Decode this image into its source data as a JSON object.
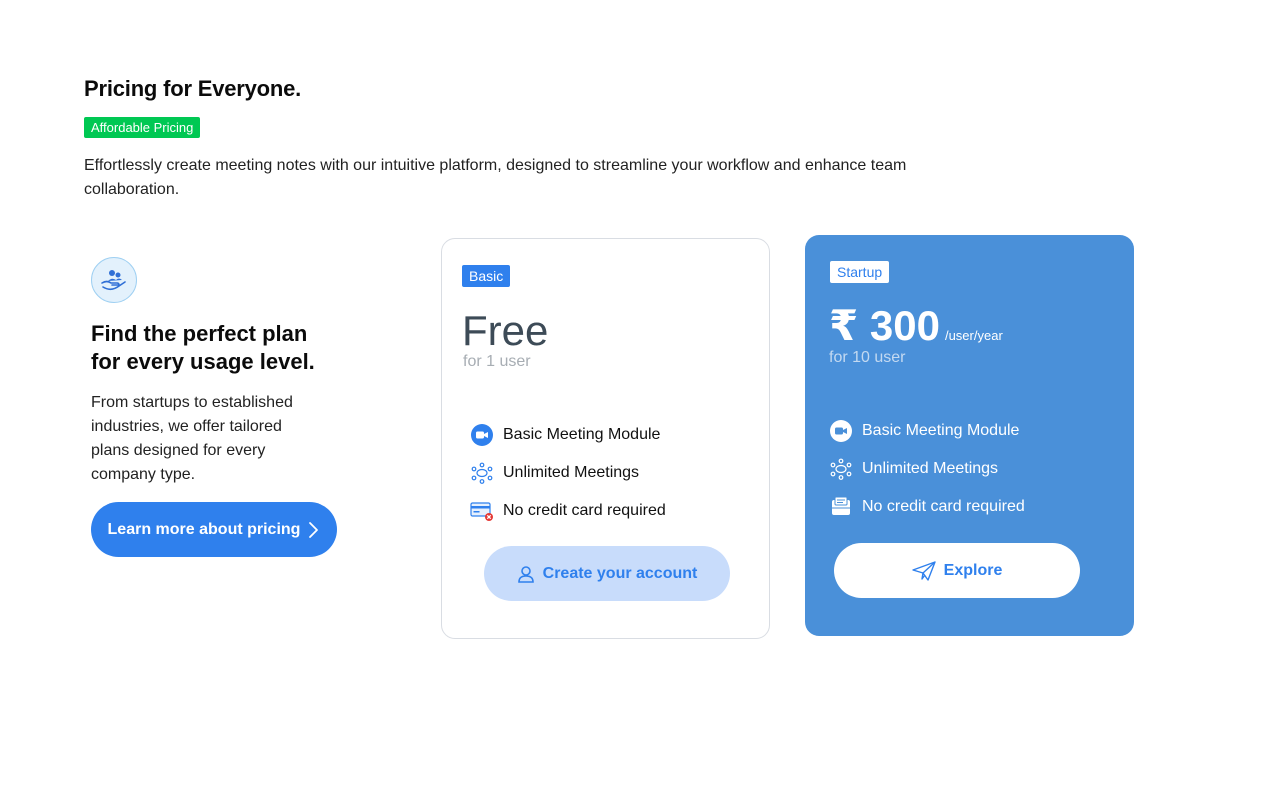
{
  "header": {
    "title": "Pricing for Everyone.",
    "badge": "Affordable Pricing",
    "description": "Effortlessly create meeting notes with our intuitive platform, designed to streamline your workflow and enhance team collaboration."
  },
  "left": {
    "icon": "hand-holding-people-icon",
    "title": "Find the perfect plan for every usage level.",
    "description": "From startups to established industries, we offer tailored plans designed for every company type.",
    "button_label": "Learn more about pricing"
  },
  "plans": [
    {
      "badge": "Basic",
      "price": "Free",
      "subtitle": "for 1 user",
      "features": [
        "Basic Meeting Module",
        "Unlimited Meetings",
        "No credit card required"
      ],
      "button_label": "Create your account",
      "button_icon": "user-icon"
    },
    {
      "badge": "Startup",
      "price": "₹ 300",
      "period": "/user/year",
      "subtitle": "for 10 user",
      "features": [
        "Basic Meeting Module",
        "Unlimited Meetings",
        "No credit card required"
      ],
      "button_label": "Explore",
      "button_icon": "paper-plane-icon"
    }
  ],
  "colors": {
    "accent": "#2f80ed",
    "badge_green": "#00c853",
    "startup_card": "#4a90d9"
  }
}
